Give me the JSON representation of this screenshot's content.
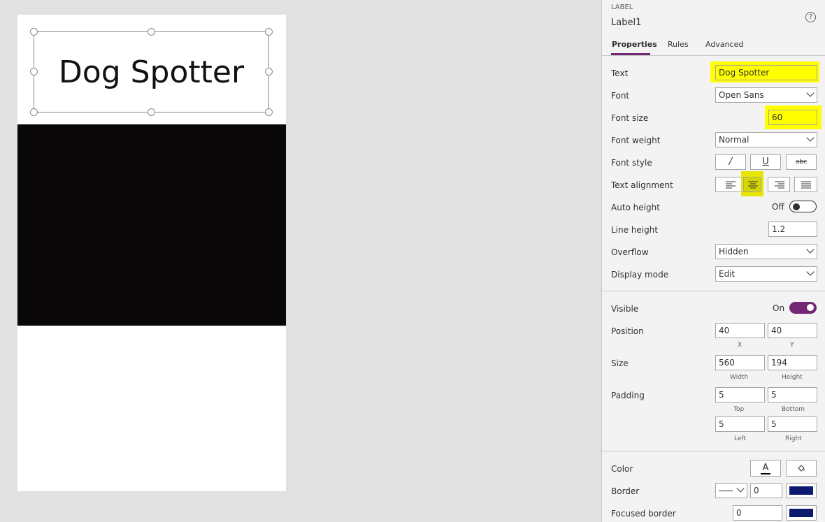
{
  "canvas": {
    "label_text": "Dog Spotter"
  },
  "panel": {
    "control_type": "LABEL",
    "control_name": "Label1",
    "help": "?",
    "tabs": [
      "Properties",
      "Rules",
      "Advanced"
    ],
    "props": {
      "text_label": "Text",
      "text_value": "Dog Spotter",
      "font_label": "Font",
      "font_value": "Open Sans",
      "font_size_label": "Font size",
      "font_size_value": "60",
      "font_weight_label": "Font weight",
      "font_weight_value": "Normal",
      "font_style_label": "Font style",
      "font_style_buttons": [
        "/",
        "U",
        "abc"
      ],
      "text_align_label": "Text alignment",
      "auto_height_label": "Auto height",
      "auto_height_state": "Off",
      "line_height_label": "Line height",
      "line_height_value": "1.2",
      "overflow_label": "Overflow",
      "overflow_value": "Hidden",
      "display_mode_label": "Display mode",
      "display_mode_value": "Edit",
      "visible_label": "Visible",
      "visible_state": "On",
      "position_label": "Position",
      "x_value": "40",
      "y_value": "40",
      "x_caption": "X",
      "y_caption": "Y",
      "size_label": "Size",
      "width_value": "560",
      "height_value": "194",
      "width_caption": "Width",
      "height_caption": "Height",
      "padding_label": "Padding",
      "pad_top_value": "5",
      "pad_bottom_value": "5",
      "pad_left_value": "5",
      "pad_right_value": "5",
      "pad_top_caption": "Top",
      "pad_bottom_caption": "Bottom",
      "pad_left_caption": "Left",
      "pad_right_caption": "Right",
      "color_label": "Color",
      "color_text_glyph": "A",
      "border_label": "Border",
      "border_value": "0",
      "focused_border_label": "Focused border",
      "focused_border_value": "0"
    },
    "colors": {
      "accent": "#742774",
      "highlight": "#ffff00",
      "border_color": "#0a1a6e",
      "image_bg": "#0a0709"
    }
  }
}
